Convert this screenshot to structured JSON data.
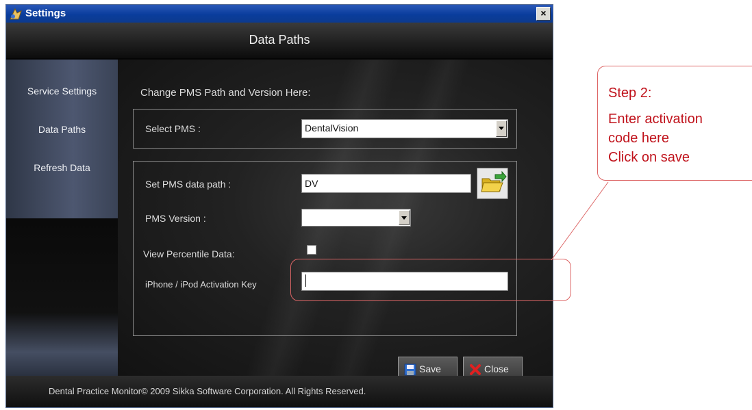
{
  "window": {
    "title": "Settings",
    "close_glyph": "×",
    "header_title": "Data Paths"
  },
  "sidebar": {
    "items": [
      {
        "label": "Service Settings"
      },
      {
        "label": "Data Paths"
      },
      {
        "label": "Refresh Data"
      }
    ]
  },
  "main": {
    "intro": "Change PMS Path and Version Here:",
    "select_pms": {
      "label": "Select PMS :",
      "value": "DentalVision"
    },
    "data_path": {
      "label": "Set PMS data path :",
      "value": "DV"
    },
    "pms_version": {
      "label": "PMS Version :",
      "value": ""
    },
    "percentile": {
      "label": "View Percentile Data:",
      "checked": false
    },
    "activation": {
      "label": "iPhone / iPod Activation Key",
      "value": ""
    },
    "buttons": {
      "save": "Save",
      "close": "Close"
    }
  },
  "footer": {
    "copyright": "Dental Practice Monitor© 2009 Sikka Software Corporation.  All Rights Reserved."
  },
  "annotation": {
    "lines": [
      "Step 2:",
      "Enter activation",
      "code here",
      "Click on save"
    ],
    "color": "#c0121b"
  }
}
